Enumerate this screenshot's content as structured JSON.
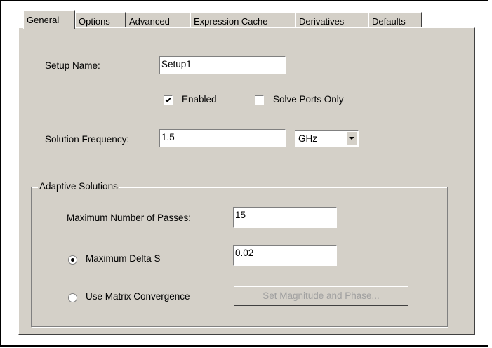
{
  "tabs": [
    "General",
    "Options",
    "Advanced",
    "Expression Cache",
    "Derivatives",
    "Defaults"
  ],
  "setup_name": {
    "label": "Setup Name:",
    "value": "Setup1"
  },
  "enabled": {
    "label": "Enabled",
    "checked": true
  },
  "solve_ports_only": {
    "label": "Solve Ports Only",
    "checked": false
  },
  "solution_frequency": {
    "label": "Solution Frequency:",
    "value": "1.5",
    "unit": "GHz"
  },
  "adaptive": {
    "title": "Adaptive Solutions",
    "max_passes_label": "Maximum Number of Passes:",
    "max_passes_value": "15",
    "delta_s_label": "Maximum Delta S",
    "delta_s_value": "0.02",
    "matrix_label": "Use Matrix Convergence",
    "set_mag_phase_label": "Set Magnitude and Phase..."
  }
}
